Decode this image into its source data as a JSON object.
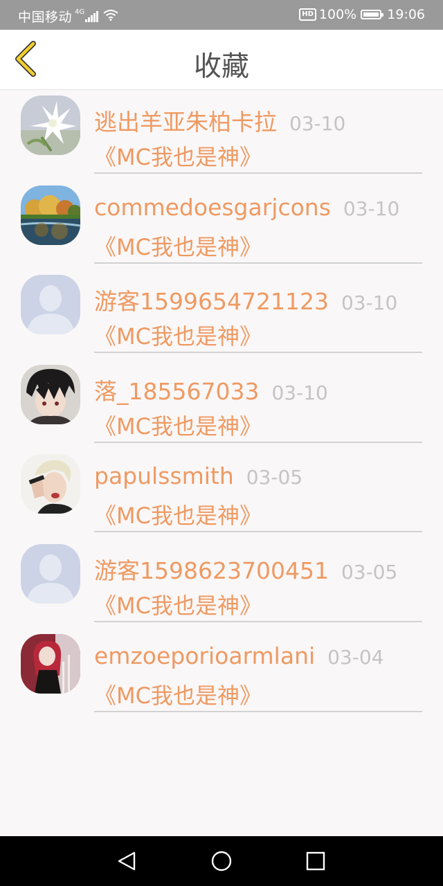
{
  "status_bar": {
    "carrier": "中国移动",
    "network": "4G",
    "hd": "HD",
    "battery": "100%",
    "time": "19:06"
  },
  "header": {
    "title": "收藏",
    "back_icon": "chevron-left-icon"
  },
  "favorites": [
    {
      "username": "逃出羊亚朱柏卡拉",
      "date": "03-10",
      "title": "《MC我也是神》",
      "avatar": "flower-photo"
    },
    {
      "username": "commedoesgarjcons",
      "date": "03-10",
      "title": "《MC我也是神》",
      "avatar": "landscape-photo"
    },
    {
      "username": "游客1599654721123",
      "date": "03-10",
      "title": "《MC我也是神》",
      "avatar": "default-avatar"
    },
    {
      "username": "落_185567033",
      "date": "03-10",
      "title": "《MC我也是神》",
      "avatar": "anime-boy"
    },
    {
      "username": "papulssmith",
      "date": "03-05",
      "title": "《MC我也是神》",
      "avatar": "person-photo"
    },
    {
      "username": "游客1598623700451",
      "date": "03-05",
      "title": "《MC我也是神》",
      "avatar": "default-avatar"
    },
    {
      "username": "emzoeporioarmlani",
      "date": "03-04",
      "title": "《MC我也是神》",
      "avatar": "anime-girl"
    }
  ],
  "nav": {
    "back": "triangle-back-icon",
    "home": "circle-home-icon",
    "recents": "square-recents-icon"
  },
  "colors": {
    "accent": "#ee9a62",
    "date": "#c4c4c4",
    "back_arrow": "#f2cf2e",
    "background": "#faf7f8"
  }
}
